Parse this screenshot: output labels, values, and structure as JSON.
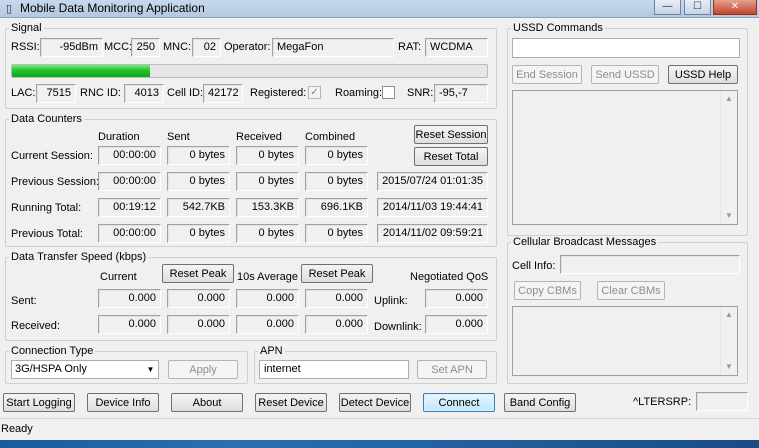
{
  "window": {
    "title": "Mobile Data Monitoring Application",
    "controls": {
      "minimize": "—",
      "maximize": "☐",
      "close": "✕"
    }
  },
  "signal": {
    "group_label": "Signal",
    "rssi_label": "RSSI:",
    "rssi": "-95dBm",
    "mcc_label": "MCC:",
    "mcc": "250",
    "mnc_label": "MNC:",
    "mnc": "02",
    "operator_label": "Operator:",
    "operator": "MegaFon",
    "rat_label": "RAT:",
    "rat": "WCDMA",
    "signal_level": 0.29,
    "signal_color": "#1fbf2a",
    "lac_label": "LAC:",
    "lac": "7515",
    "rnc_label": "RNC ID:",
    "rnc": "4013",
    "cell_label": "Cell ID:",
    "cell": "42172",
    "registered_label": "Registered:",
    "registered": true,
    "roaming_label": "Roaming:",
    "roaming": false,
    "snr_label": "SNR:",
    "snr": "-95,-7"
  },
  "counters": {
    "group_label": "Data Counters",
    "columns": [
      "Duration",
      "Sent",
      "Received",
      "Combined"
    ],
    "reset_session": "Reset Session",
    "reset_total": "Reset Total",
    "rows": [
      {
        "label": "Current Session:",
        "duration": "00:00:00",
        "sent": "0 bytes",
        "received": "0 bytes",
        "combined": "0 bytes",
        "date": ""
      },
      {
        "label": "Previous Session:",
        "duration": "00:00:00",
        "sent": "0 bytes",
        "received": "0 bytes",
        "combined": "0 bytes",
        "date": "2015/07/24 01:01:35"
      },
      {
        "label": "Running Total:",
        "duration": "00:19:12",
        "sent": "542.7KB",
        "received": "153.3KB",
        "combined": "696.1KB",
        "date": "2014/11/03 19:44:41"
      },
      {
        "label": "Previous Total:",
        "duration": "00:00:00",
        "sent": "0 bytes",
        "received": "0 bytes",
        "combined": "0 bytes",
        "date": "2014/11/02 09:59:21"
      }
    ]
  },
  "speed": {
    "group_label": "Data Transfer Speed (kbps)",
    "current_label": "Current",
    "reset_peak_1": "Reset Peak",
    "avg_label": "10s Average",
    "reset_peak_2": "Reset Peak",
    "negotiated_label": "Negotiated QoS",
    "sent_label": "Sent:",
    "received_label": "Received:",
    "uplink_label": "Uplink:",
    "downlink_label": "Downlink:",
    "sent_values": [
      "0.000",
      "0.000",
      "0.000",
      "0.000",
      "0.000"
    ],
    "received_values": [
      "0.000",
      "0.000",
      "0.000",
      "0.000",
      "0.000"
    ]
  },
  "connection": {
    "group_label": "Connection Type",
    "selected": "3G/HSPA Only",
    "apply": "Apply"
  },
  "apn": {
    "group_label": "APN",
    "value": "internet",
    "set_apn": "Set APN"
  },
  "ussd": {
    "group_label": "USSD Commands",
    "input": "",
    "end_session": "End Session",
    "send_ussd": "Send USSD",
    "help": "USSD Help"
  },
  "cbm": {
    "group_label": "Cellular Broadcast Messages",
    "cell_info_label": "Cell Info:",
    "cell_info": "",
    "copy": "Copy CBMs",
    "clear": "Clear CBMs"
  },
  "bottom": {
    "start_logging": "Start Logging",
    "device_info": "Device Info",
    "about": "About",
    "reset_device": "Reset Device",
    "detect_device": "Detect Device",
    "connect": "Connect",
    "band_config": "Band Config",
    "lte_label": "^LTERSRP:",
    "lte_value": ""
  },
  "status": {
    "text": "Ready"
  }
}
